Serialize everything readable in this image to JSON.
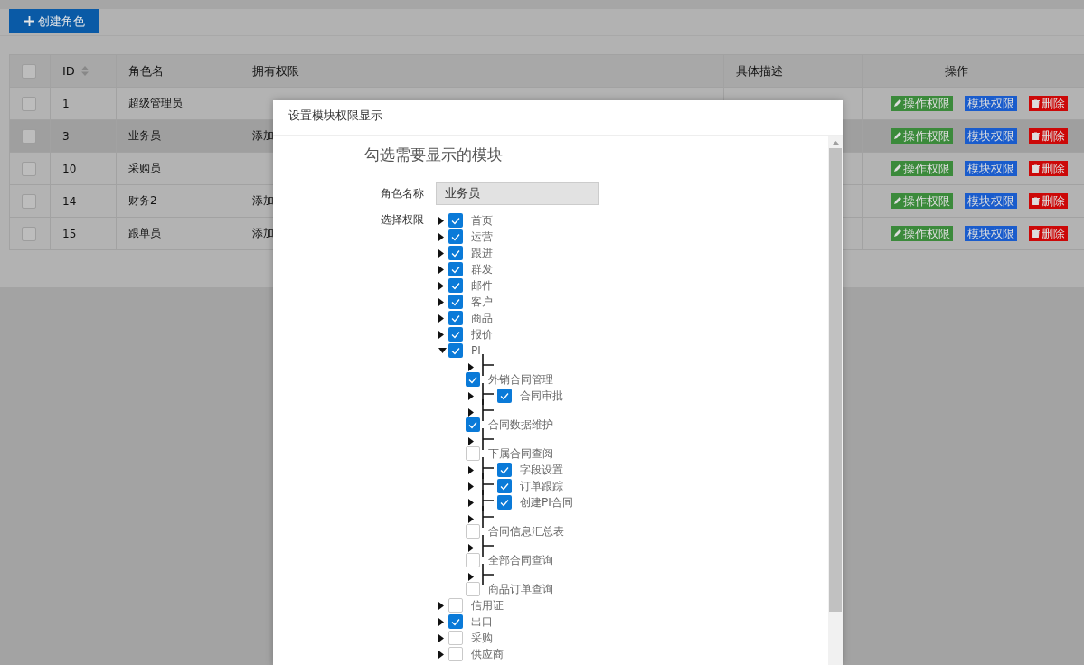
{
  "toolbar": {
    "create_button": "创建角色"
  },
  "table": {
    "select_all_checked": false,
    "columns": [
      {
        "kind": "checkbox"
      },
      {
        "label": "ID",
        "kind": "sortable"
      },
      {
        "label": "角色名",
        "kind": "text"
      },
      {
        "label": "拥有权限",
        "kind": "text"
      },
      {
        "label": "具体描述",
        "kind": "text"
      },
      {
        "label": "操作",
        "kind": "actions"
      }
    ],
    "rows": [
      {
        "checked": false,
        "selected": false,
        "id": "1",
        "name": "超级管理员",
        "actions": [
          {
            "kind": "edit",
            "label": "操作权限"
          },
          {
            "kind": "module",
            "label": "模块权限"
          },
          {
            "kind": "delete",
            "label": "删除"
          }
        ]
      },
      {
        "checked": false,
        "selected": true,
        "id": "3",
        "name": "业务员",
        "permissions": "添加",
        "actions": [
          {
            "kind": "edit",
            "label": "操作权限"
          },
          {
            "kind": "module",
            "label": "模块权限"
          },
          {
            "kind": "delete",
            "label": "删除"
          }
        ]
      },
      {
        "checked": false,
        "selected": false,
        "id": "10",
        "name": "采购员",
        "actions": [
          {
            "kind": "edit",
            "label": "操作权限"
          },
          {
            "kind": "module",
            "label": "模块权限"
          },
          {
            "kind": "delete",
            "label": "删除"
          }
        ]
      },
      {
        "checked": false,
        "selected": false,
        "id": "14",
        "name": "财务2",
        "permissions": "添加",
        "actions": [
          {
            "kind": "edit",
            "label": "操作权限"
          },
          {
            "kind": "module",
            "label": "模块权限"
          },
          {
            "kind": "delete",
            "label": "删除"
          }
        ]
      },
      {
        "checked": false,
        "selected": false,
        "id": "15",
        "name": "跟单员",
        "permissions": "添加",
        "actions": [
          {
            "kind": "edit",
            "label": "操作权限"
          },
          {
            "kind": "module",
            "label": "模块权限"
          },
          {
            "kind": "delete",
            "label": "删除"
          }
        ]
      }
    ]
  },
  "dialog": {
    "title": "设置模块权限显示",
    "legend": "勾选需要显示的模块",
    "role_label": "角色名称",
    "role_value": "业务员",
    "permission_label": "选择权限",
    "tree": [
      {
        "label": "首页",
        "checked": true,
        "expanded": false
      },
      {
        "label": "运营",
        "checked": true,
        "expanded": false
      },
      {
        "label": "跟进",
        "checked": true,
        "expanded": false
      },
      {
        "label": "群发",
        "checked": true,
        "expanded": false
      },
      {
        "label": "邮件",
        "checked": true,
        "expanded": false
      },
      {
        "label": "客户",
        "checked": true,
        "expanded": false
      },
      {
        "label": "商品",
        "checked": true,
        "expanded": false
      },
      {
        "label": "报价",
        "checked": true,
        "expanded": false
      },
      {
        "label": "PI",
        "checked": true,
        "expanded": true,
        "children": [
          {
            "kind": "branch"
          },
          {
            "kind": "item",
            "label": "外销合同管理",
            "checked": true
          },
          {
            "kind": "branch",
            "label": "合同审批",
            "checked": true
          },
          {
            "kind": "branch"
          },
          {
            "kind": "item",
            "label": "合同数据维护",
            "checked": true
          },
          {
            "kind": "branch"
          },
          {
            "kind": "item",
            "label": "下属合同查阅",
            "checked": false
          },
          {
            "kind": "branch",
            "label": "字段设置",
            "checked": true
          },
          {
            "kind": "branch",
            "label": "订单跟踪",
            "checked": true
          },
          {
            "kind": "branch",
            "label": "创建PI合同",
            "checked": true
          },
          {
            "kind": "branch"
          },
          {
            "kind": "item",
            "label": "合同信息汇总表",
            "checked": false
          },
          {
            "kind": "branch"
          },
          {
            "kind": "item",
            "label": "全部合同查询",
            "checked": false
          },
          {
            "kind": "branch"
          },
          {
            "kind": "item",
            "label": "商品订单查询",
            "checked": false
          }
        ]
      },
      {
        "label": "信用证",
        "checked": false,
        "expanded": false
      },
      {
        "label": "出口",
        "checked": true,
        "expanded": false
      },
      {
        "label": "采购",
        "checked": false,
        "expanded": false
      },
      {
        "label": "供应商",
        "checked": false,
        "expanded": false
      }
    ]
  }
}
